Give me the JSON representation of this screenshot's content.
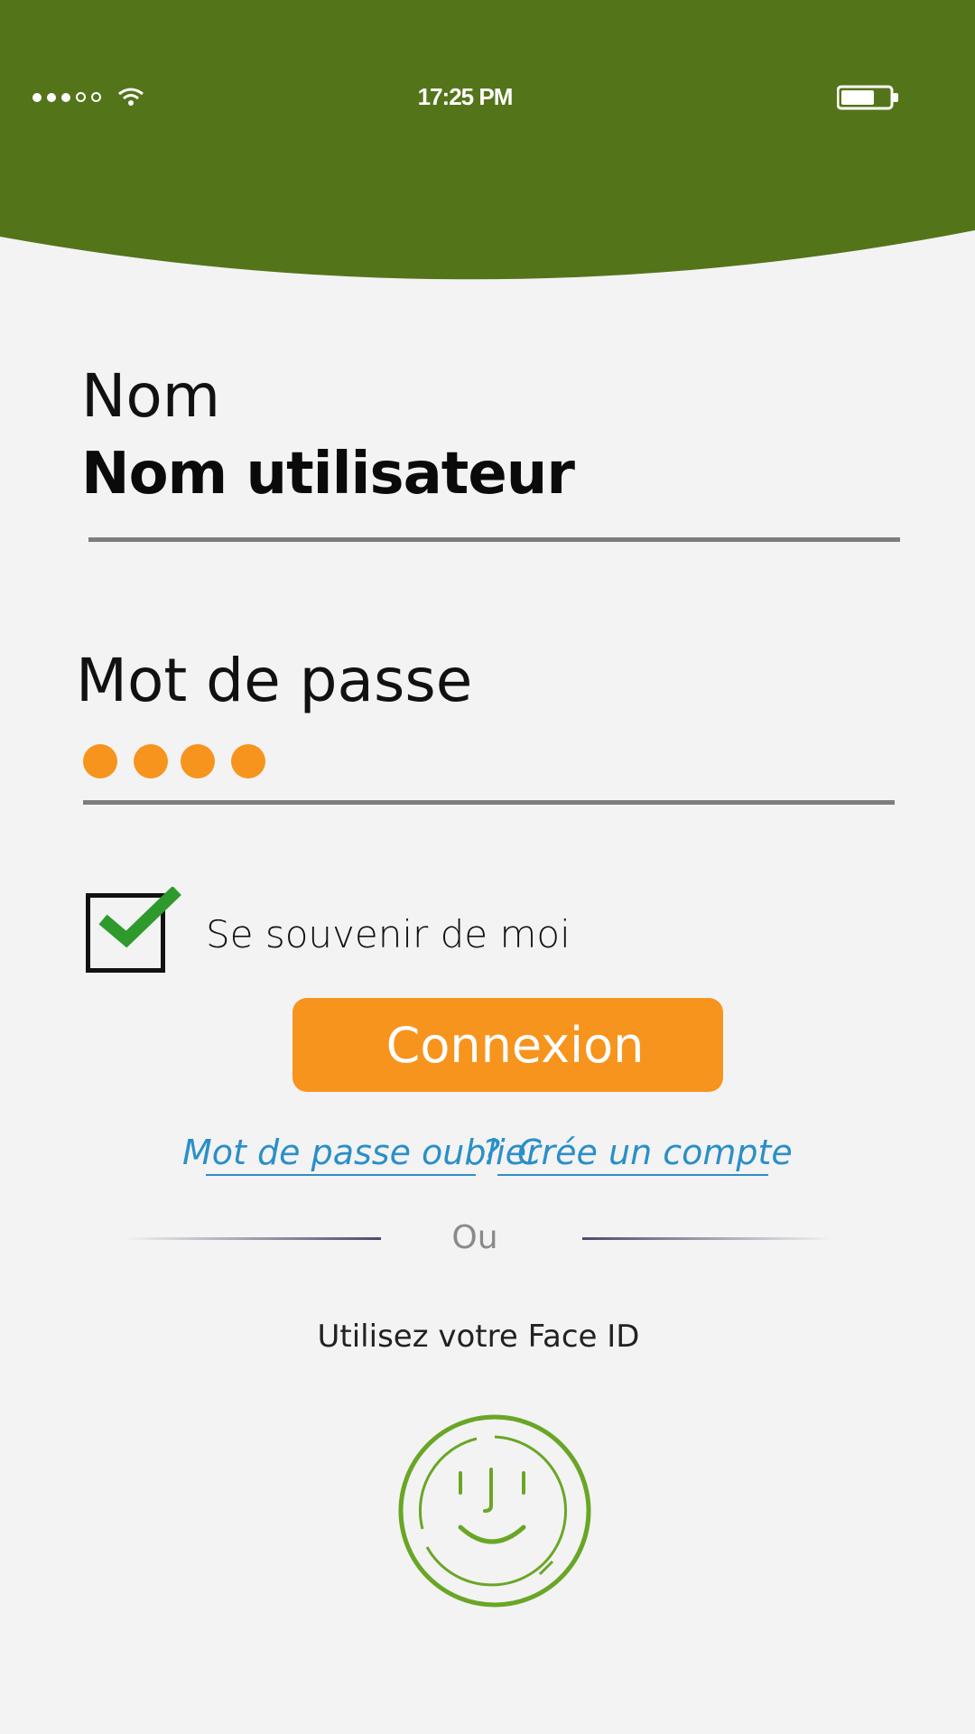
{
  "status_bar": {
    "time": "17:25 PM",
    "signal_icon": "signal-dots-icon",
    "wifi_icon": "wifi-icon",
    "battery_icon": "battery-icon"
  },
  "colors": {
    "header_green": "#54741a",
    "accent_orange": "#f7941d",
    "link_blue": "#2a8fc8",
    "check_green": "#2e9a2c",
    "faceid_green": "#6aa626"
  },
  "form": {
    "name_label": "Nom",
    "name_value": "Nom utilisateur",
    "password_label": "Mot de passe",
    "password_masked_length": 4,
    "remember_label": "Se souvenir de moi",
    "remember_checked": true,
    "login_button": "Connexion"
  },
  "links": {
    "forgot": "Mot de passe oublier",
    "separator": "?",
    "create": "Crée un compte"
  },
  "divider": {
    "or_text": "Ou"
  },
  "faceid": {
    "prompt": "Utilisez votre Face ID",
    "icon": "face-id-icon"
  }
}
